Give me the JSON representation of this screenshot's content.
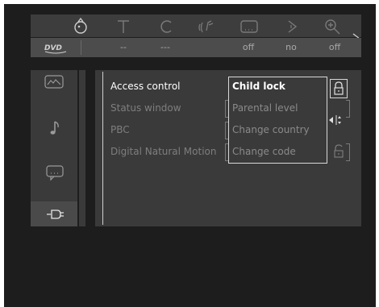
{
  "topbar": {
    "icons": [
      "angle-icon",
      "subtitle-t-icon",
      "chapter-c-icon",
      "audio-icon",
      "caption-icon",
      "play-icon",
      "zoom-icon"
    ],
    "disc_icon": "dvd-icon"
  },
  "values": [
    "--",
    "---",
    "off",
    "no",
    "off"
  ],
  "sidebar": {
    "icons": [
      "picture-icon",
      "music-note-icon",
      "speech-icon",
      "settings-plug-icon"
    ],
    "selected": "settings-plug-icon"
  },
  "menu": {
    "items": [
      "Access control",
      "Status window",
      "PBC",
      "Digital Natural Motion"
    ],
    "active_index": 0
  },
  "submenu": {
    "items": [
      "Child lock",
      "Parental level",
      "Change country",
      "Change code"
    ],
    "active_index": 0
  },
  "colors": {
    "background": "#1d1d1d",
    "panel": "#3a3a3a",
    "text_active": "#ffffff",
    "text_inactive": "#7e7e7e"
  }
}
